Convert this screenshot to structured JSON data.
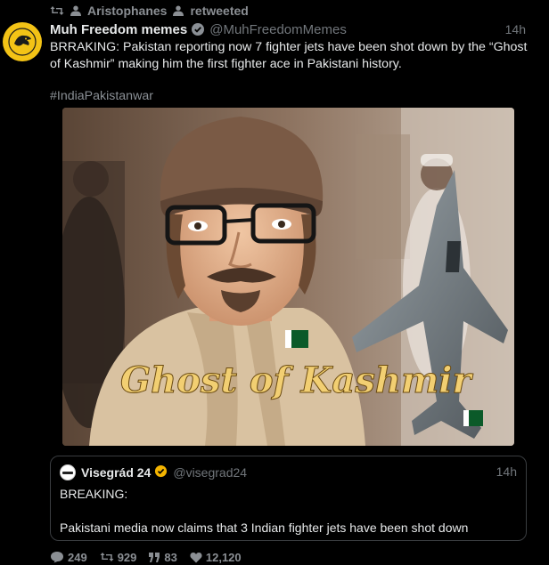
{
  "retweet": {
    "user": "Aristophanes",
    "action": "retweeted"
  },
  "tweet": {
    "display_name": "Muh Freedom memes",
    "handle": "@MuhFreedomMemes",
    "time": "14h",
    "verified_color": "#8a8f95",
    "text": "BRRAKING: Pakistan reporting now 7 fighter jets have been shot down by the “Ghost of Kashmir” making him the first fighter ace in Pakistani history.",
    "hashtag": "#IndiaPakistanwar",
    "avatar": {
      "color": "#f3c316",
      "icon": "eagle-logo-icon"
    }
  },
  "media": {
    "caption": "Ghost of Kashmir",
    "icon": "fighter-jet-icon",
    "caption_color": "#f2cf72"
  },
  "quote": {
    "display_name": "Visegrád 24",
    "handle": "@visegrad24",
    "time": "14h",
    "verified_color": "#f4b400",
    "line1": "BREAKING:",
    "line2": "Pakistani media now claims that 3 Indian fighter jets have been shot down"
  },
  "actions": {
    "replies": "249",
    "retweets": "929",
    "quotes": "83",
    "likes": "12,120"
  }
}
